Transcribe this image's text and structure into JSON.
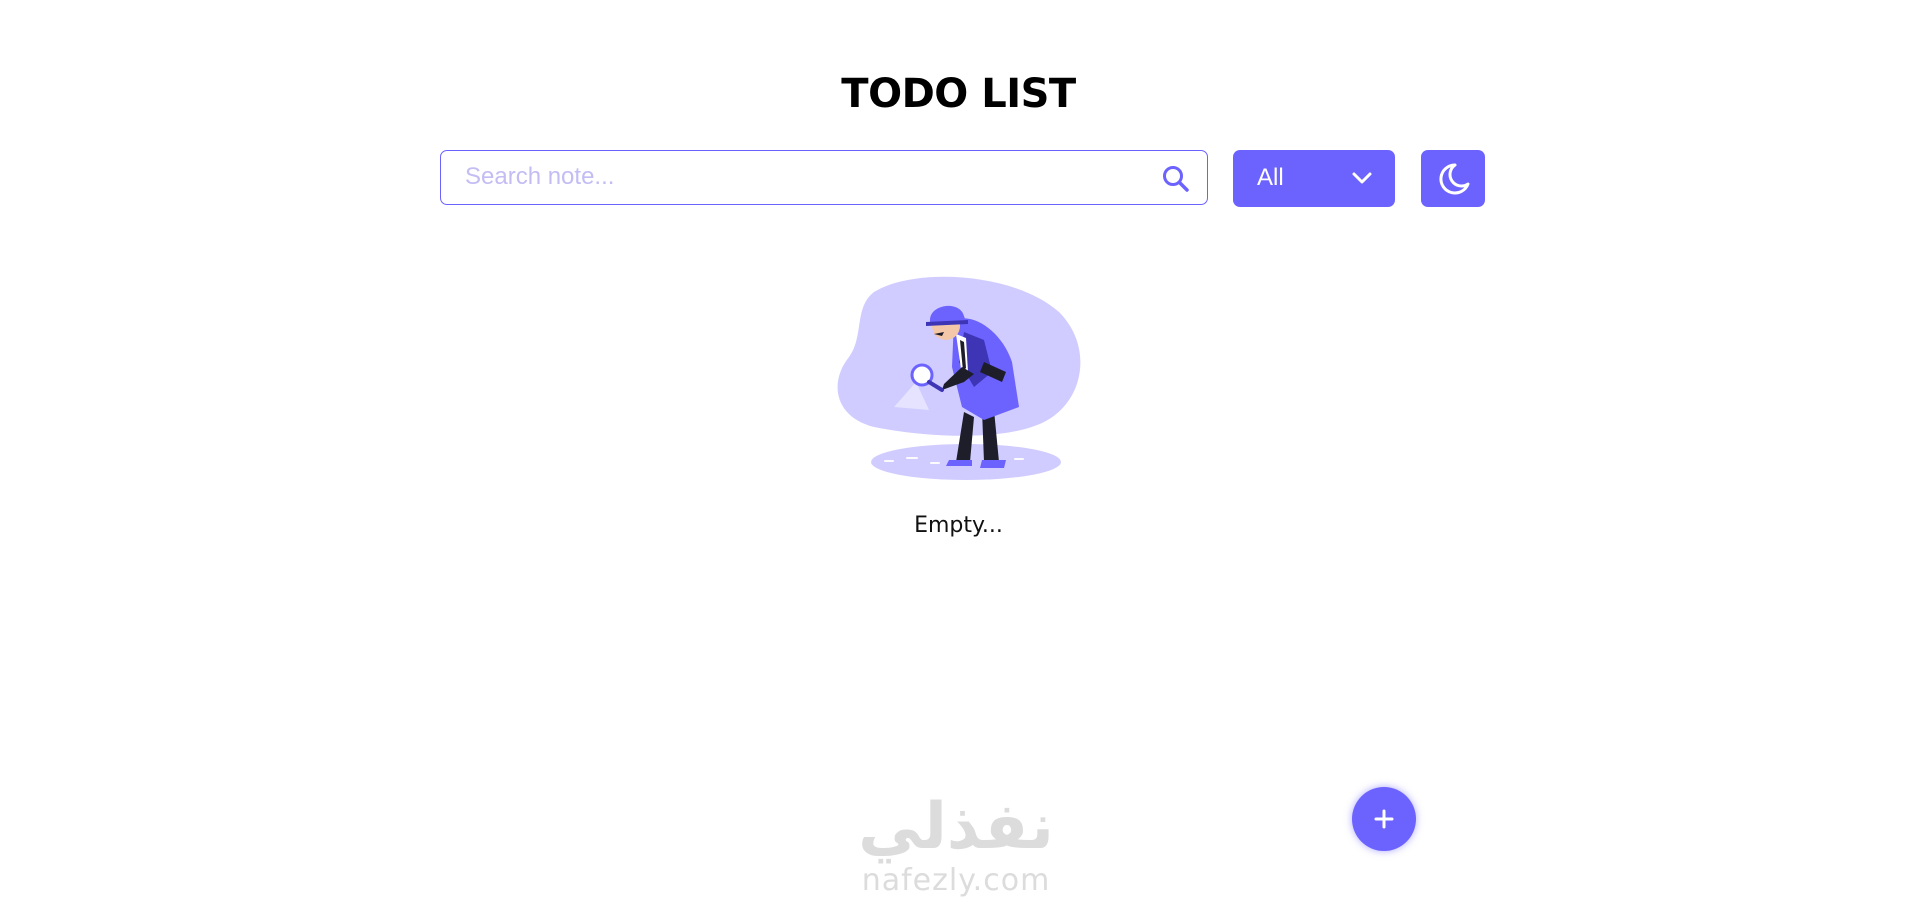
{
  "header": {
    "title": "TODO LIST"
  },
  "search": {
    "placeholder": "Search note...",
    "value": "",
    "icon": "search-icon"
  },
  "filter": {
    "selected": "All",
    "icon": "chevron-down-icon"
  },
  "theme_toggle": {
    "icon": "moon-icon"
  },
  "empty_state": {
    "illustration": "detective-magnifying-glass",
    "text": "Empty..."
  },
  "add_button": {
    "icon": "plus-icon"
  },
  "watermark": {
    "arabic": "نفذلي",
    "latin": "nafezly.com"
  },
  "colors": {
    "accent": "#6c63ff",
    "accent_light": "#c3bdf4",
    "background": "#ffffff",
    "text": "#000000"
  }
}
